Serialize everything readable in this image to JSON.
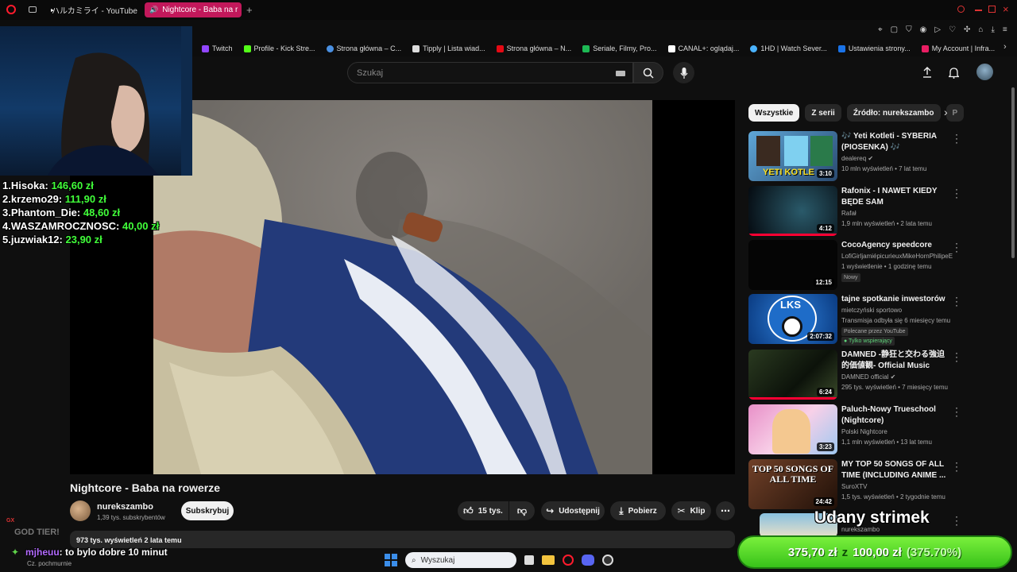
{
  "browser": {
    "tabs": [
      {
        "label": "ハルカミライ - YouTube",
        "active": false
      },
      {
        "label": "Nightcore - Baba na r",
        "active": true
      }
    ],
    "new_tab_label": "+",
    "bookmarks": [
      {
        "label": "Twitch",
        "color": "#9146ff"
      },
      {
        "label": "Profile - Kick Stre...",
        "color": "#53fc18"
      },
      {
        "label": "Strona główna – C...",
        "color": "#4a90e2"
      },
      {
        "label": "Tipply | Lista wiad...",
        "color": "#dddddd"
      },
      {
        "label": "Strona główna – N...",
        "color": "#e50914"
      },
      {
        "label": "Seriale, Filmy, Pro...",
        "color": "#1db954"
      },
      {
        "label": "CANAL+: oglądaj...",
        "color": "#ffffff"
      },
      {
        "label": "1HD | Watch Sever...",
        "color": "#4ab3ff"
      },
      {
        "label": "Ustawienia strony...",
        "color": "#1a73e8"
      },
      {
        "label": "My Account | Infra...",
        "color": "#e91e63"
      }
    ]
  },
  "header": {
    "search_placeholder": "Szukaj"
  },
  "overlay": {
    "donations": [
      {
        "rank": "1.",
        "name": "Hisoka:",
        "amount": "146,60 zł"
      },
      {
        "rank": "2.",
        "name": "krzemo29:",
        "amount": "111,90 zł"
      },
      {
        "rank": "3.",
        "name": "Phantom_Die:",
        "amount": "48,60 zł"
      },
      {
        "rank": "4.",
        "name": "WASZAMROCZNOSC:",
        "amount": "40,00 zł"
      },
      {
        "rank": "5.",
        "name": "juzwiak12:",
        "amount": "23,90 zł"
      }
    ],
    "chat_top": "GOD TIER!",
    "chat_user": "mjheuu",
    "chat_msg": ": to bylo dobre 10 minut",
    "weather": "Cz. pochmurnie",
    "gx": "GX",
    "stream_label": "Udany strimek",
    "goal_current": "375,70 zł",
    "goal_z": "z",
    "goal_target": "100,00 zł",
    "goal_pct": "(375.70%)"
  },
  "video": {
    "title": "Nightcore - Baba na rowerze",
    "channel": "nurekszambo",
    "subscribers": "1,39 tys. subskrybentów",
    "subscribe_label": "Subskrybuj",
    "likes": "15 tys.",
    "share_label": "Udostępnij",
    "download_label": "Pobierz",
    "clip_label": "Klip",
    "views_line": "973 tys. wyświetleń  2 lata temu"
  },
  "taskbar": {
    "search_placeholder": "Wyszukaj"
  },
  "sidebar": {
    "chips": [
      "Wszystkie",
      "Z serii",
      "Źródło: nurekszambo",
      "P"
    ],
    "items": [
      {
        "title": "🎶 Yeti Kotleti - SYBERIA (PIOSENKA) 🎶",
        "channel": "dealereq ✔",
        "meta": "10 mln wyświetleń • 7 lat temu",
        "duration": "3:10",
        "badge": "",
        "progress": 0,
        "thumb_text": "YETI KOTLE"
      },
      {
        "title": "Rafonix - I NAWET KIEDY BĘDE SAM",
        "channel": "Rafał",
        "meta": "1,9 mln wyświetleń • 2 lata temu",
        "duration": "4:12",
        "badge": "",
        "progress": 1,
        "thumb_text": ""
      },
      {
        "title": "CocoAgency speedcore",
        "channel": "LofiGirljamiépicurieuxMikeHornPhilipeEt...",
        "meta": "1 wyświetlenie • 1 godzinę temu",
        "duration": "12:15",
        "badge": "Nowy",
        "progress": 0,
        "thumb_text": ""
      },
      {
        "title": "tajne spotkanie inwestorów",
        "channel": "mietczyński sportowo",
        "meta": "Transmisja odbyła się 6 miesięcy temu",
        "duration": "2:07:32",
        "badge": "Polecane przez YouTube",
        "badge2": "Tylko wspierający",
        "progress": 0,
        "thumb_text": "LKS"
      },
      {
        "title": "DAMNED -静狂と交わる強迫的価値観- Official Music Video",
        "channel": "DAMNED official ✔",
        "meta": "295 tys. wyświetleń • 7 miesięcy temu",
        "duration": "6:24",
        "badge": "",
        "progress": 1,
        "thumb_text": ""
      },
      {
        "title": "Paluch-Nowy Trueschool (Nightcore)",
        "channel": "Polski Nightcore",
        "meta": "1,1 mln wyświetleń • 13 lat temu",
        "duration": "3:23",
        "badge": "",
        "progress": 0,
        "thumb_text": ""
      },
      {
        "title": "MY TOP 50 SONGS OF ALL TIME (INCLUDING ANIME ...",
        "channel": "SuroXTV",
        "meta": "1,5 tys. wyświetleń • 2 tygodnie temu",
        "duration": "24:42",
        "badge": "",
        "progress": 0,
        "thumb_text": "TOP 50 SONGS OF ALL TIME"
      },
      {
        "title": "",
        "channel": "nurekszambo",
        "meta": "",
        "duration": "",
        "badge": "",
        "progress": 0,
        "thumb_text": ""
      }
    ]
  },
  "colors": {
    "accent": "#ff0033",
    "tab_active": "#c2185b",
    "donation_amount": "#41ff3a",
    "goal_green": "#38c21a"
  }
}
